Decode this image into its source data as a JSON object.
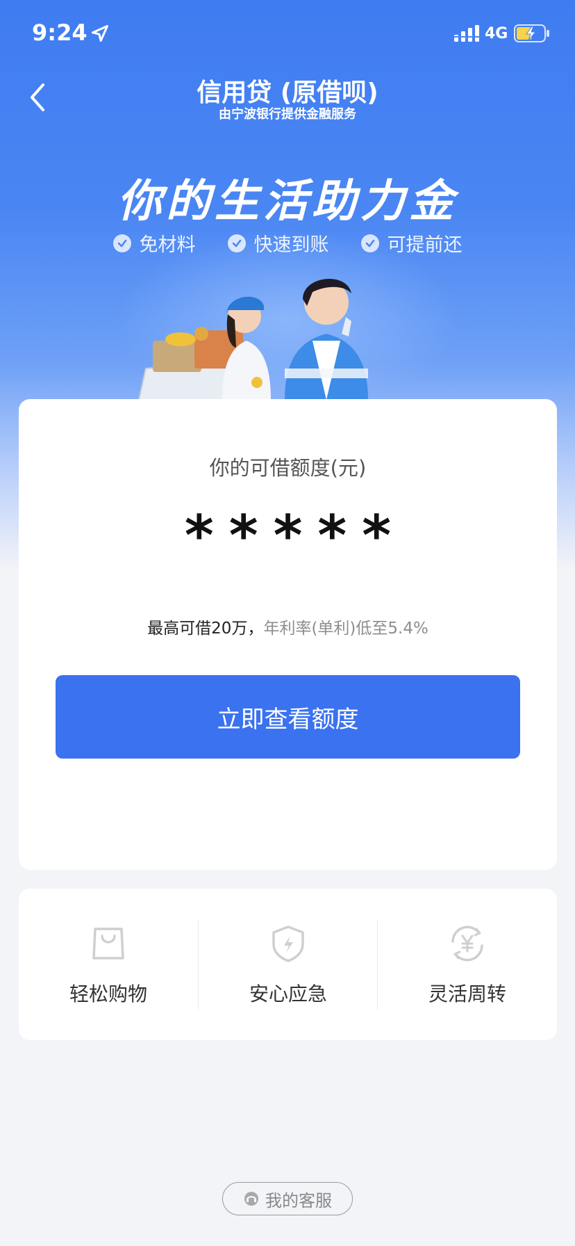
{
  "status_bar": {
    "time": "9:24",
    "network": "4G"
  },
  "nav": {
    "title": "信用贷 (原借呗)",
    "subtitle": "由宁波银行提供金融服务"
  },
  "hero": {
    "title": "你的生活助力金",
    "features": [
      "免材料",
      "快速到账",
      "可提前还"
    ]
  },
  "credit_card": {
    "label": "你的可借额度(元)",
    "amount": "*****",
    "desc_strong": "最高可借20万，",
    "desc_muted": "年利率(单利)低至5.4%",
    "button_label": "立即查看额度"
  },
  "usage": {
    "items": [
      {
        "label": "轻松购物",
        "icon": "shopping-bag-icon"
      },
      {
        "label": "安心应急",
        "icon": "shield-icon"
      },
      {
        "label": "灵活周转",
        "icon": "yuan-cycle-icon"
      }
    ]
  },
  "service": {
    "label": "我的客服"
  },
  "colors": {
    "primary": "#3a72f0",
    "hero_top": "#3f7cf1",
    "page_bg": "#f3f4f8"
  }
}
